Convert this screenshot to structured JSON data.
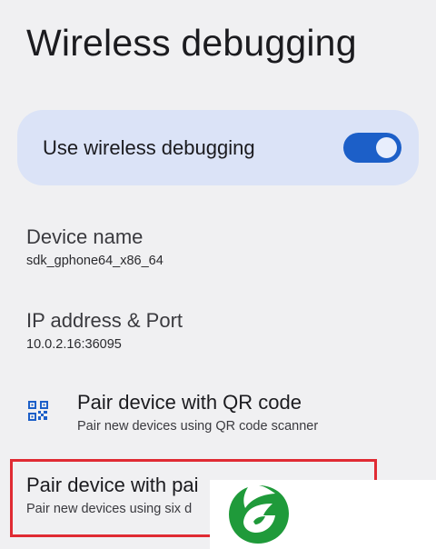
{
  "page": {
    "title": "Wireless debugging"
  },
  "main_switch": {
    "label": "Use wireless debugging",
    "checked": true,
    "colors": {
      "card": "#dbe3f7",
      "track": "#1c5fc8",
      "thumb": "#e8eefc"
    }
  },
  "device_name": {
    "title": "Device name",
    "summary": "sdk_gphone64_x86_64"
  },
  "ip_address": {
    "title": "IP address & Port",
    "summary": "10.0.2.16:36095"
  },
  "pair_qr": {
    "icon": "qr-code-scanner-icon",
    "title": "Pair device with QR code",
    "summary": "Pair new devices using QR code scanner"
  },
  "pair_code": {
    "title": "Pair device with pai",
    "summary": "Pair new devices using six d"
  },
  "highlight": {
    "color": "#e02b33"
  },
  "watermark": {
    "icon": "green-leaf-logo-icon",
    "color": "#1f9a3a"
  }
}
